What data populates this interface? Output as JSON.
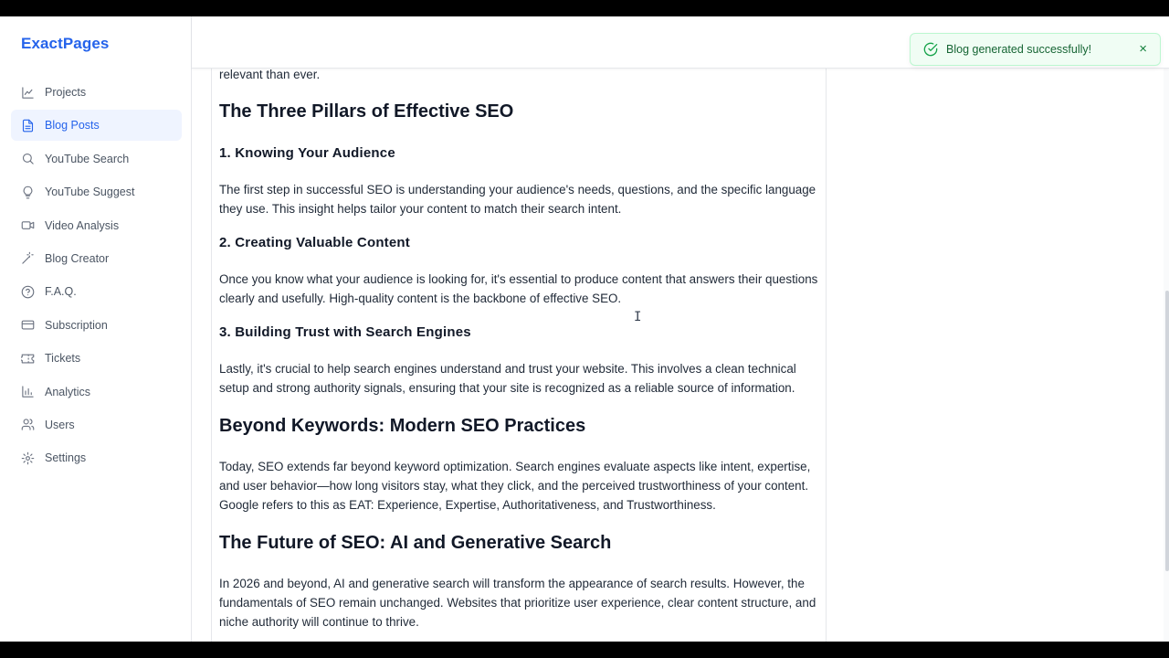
{
  "app": {
    "brand": "ExactPages"
  },
  "sidebar": {
    "items": [
      {
        "label": "Projects",
        "icon": "chart-icon",
        "active": false
      },
      {
        "label": "Blog Posts",
        "icon": "document-icon",
        "active": true
      },
      {
        "label": "YouTube Search",
        "icon": "search-icon",
        "active": false
      },
      {
        "label": "YouTube Suggest",
        "icon": "lightbulb-icon",
        "active": false
      },
      {
        "label": "Video Analysis",
        "icon": "video-icon",
        "active": false
      },
      {
        "label": "Blog Creator",
        "icon": "magic-wand-icon",
        "active": false
      },
      {
        "label": "F.A.Q.",
        "icon": "help-circle-icon",
        "active": false
      },
      {
        "label": "Subscription",
        "icon": "credit-card-icon",
        "active": false
      },
      {
        "label": "Tickets",
        "icon": "ticket-icon",
        "active": false
      },
      {
        "label": "Analytics",
        "icon": "bar-chart-icon",
        "active": false
      },
      {
        "label": "Users",
        "icon": "users-icon",
        "active": false
      },
      {
        "label": "Settings",
        "icon": "gear-icon",
        "active": false
      }
    ]
  },
  "article": {
    "intro_tail": "relevant than ever.",
    "h_pillars": "The Three Pillars of Effective SEO",
    "h_knowing": "1. Knowing Your Audience",
    "p_knowing": "The first step in successful SEO is understanding your audience's needs, questions, and the specific language they use. This insight helps tailor your content to match their search intent.",
    "h_creating": "2. Creating Valuable Content",
    "p_creating": "Once you know what your audience is looking for, it's essential to produce content that answers their questions clearly and usefully. High-quality content is the backbone of effective SEO.",
    "h_trust": "3. Building Trust with Search Engines",
    "p_trust": "Lastly, it's crucial to help search engines understand and trust your website. This involves a clean technical setup and strong authority signals, ensuring that your site is recognized as a reliable source of information.",
    "h_beyond": "Beyond Keywords: Modern SEO Practices",
    "p_beyond": "Today, SEO extends far beyond keyword optimization. Search engines evaluate aspects like intent, expertise, and user behavior—how long visitors stay, what they click, and the perceived trustworthiness of your content. Google refers to this as EAT: Experience, Expertise, Authoritativeness, and Trustworthiness.",
    "h_future": "The Future of SEO: AI and Generative Search",
    "p_future": "In 2026 and beyond, AI and generative search will transform the appearance of search results. However, the fundamentals of SEO remain unchanged. Websites that prioritize user experience, clear content structure, and niche authority will continue to thrive."
  },
  "toast": {
    "message": "Blog generated successfully!",
    "close": "×",
    "icon": "check-circle-icon"
  },
  "colors": {
    "accent": "#2563eb",
    "active_bg": "#eff4ff",
    "toast_bg": "#f0fdf4",
    "toast_text": "#166534"
  }
}
